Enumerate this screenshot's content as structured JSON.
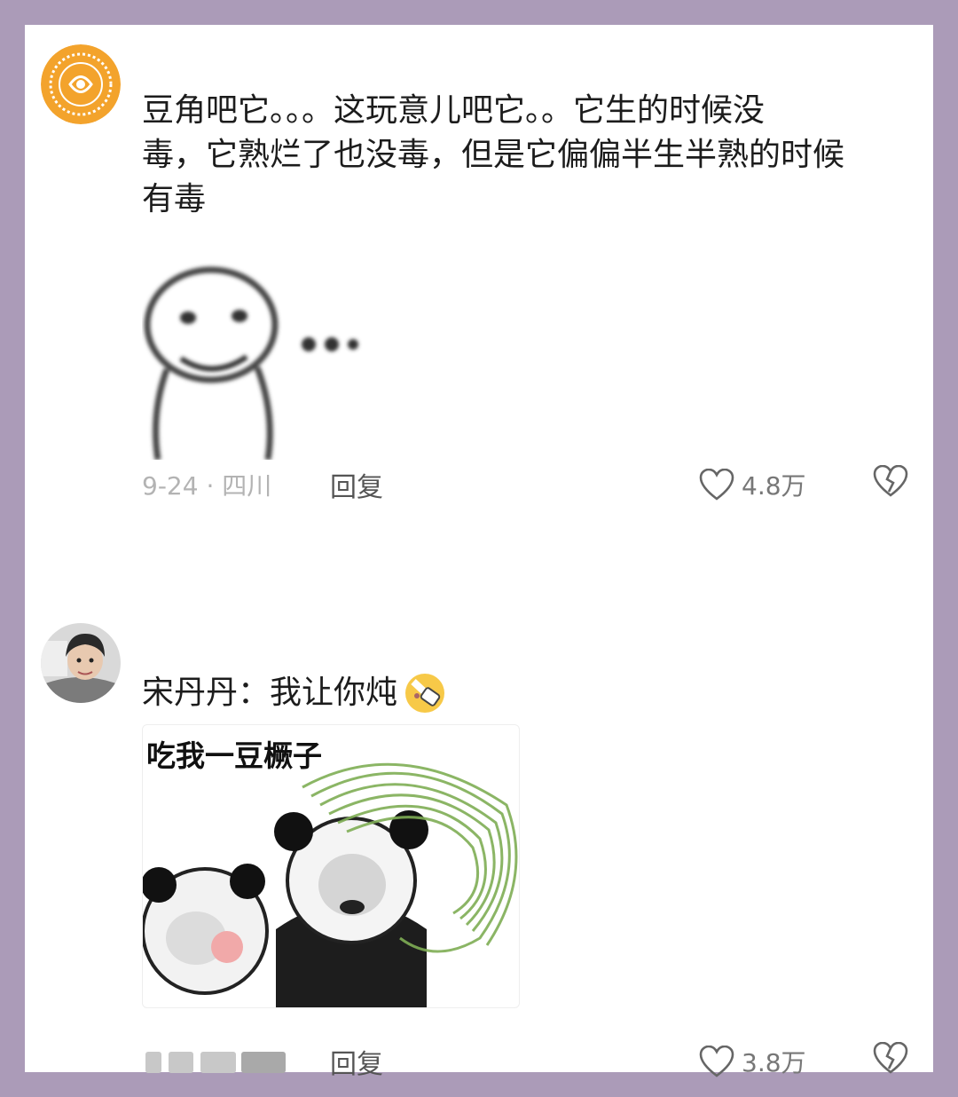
{
  "comments": [
    {
      "text_lines": [
        "豆角吧它。。。这玩意儿吧它。。它生的时候没",
        "毒，它熟烂了也没毒，但是它偏偏半生半熟的时候",
        "有毒"
      ],
      "meta": "9-24 · 四川",
      "reply_label": "回复",
      "likes": "4.8万"
    },
    {
      "text": "宋丹丹：我让你炖",
      "image_caption": "吃我一豆橛子",
      "reply_label": "回复",
      "likes": "3.8万"
    }
  ],
  "colors": {
    "background": "#ab9bb8",
    "card": "#ffffff",
    "meta_gray": "#b3b3b3",
    "avatar_orange": "#f3a32c"
  }
}
